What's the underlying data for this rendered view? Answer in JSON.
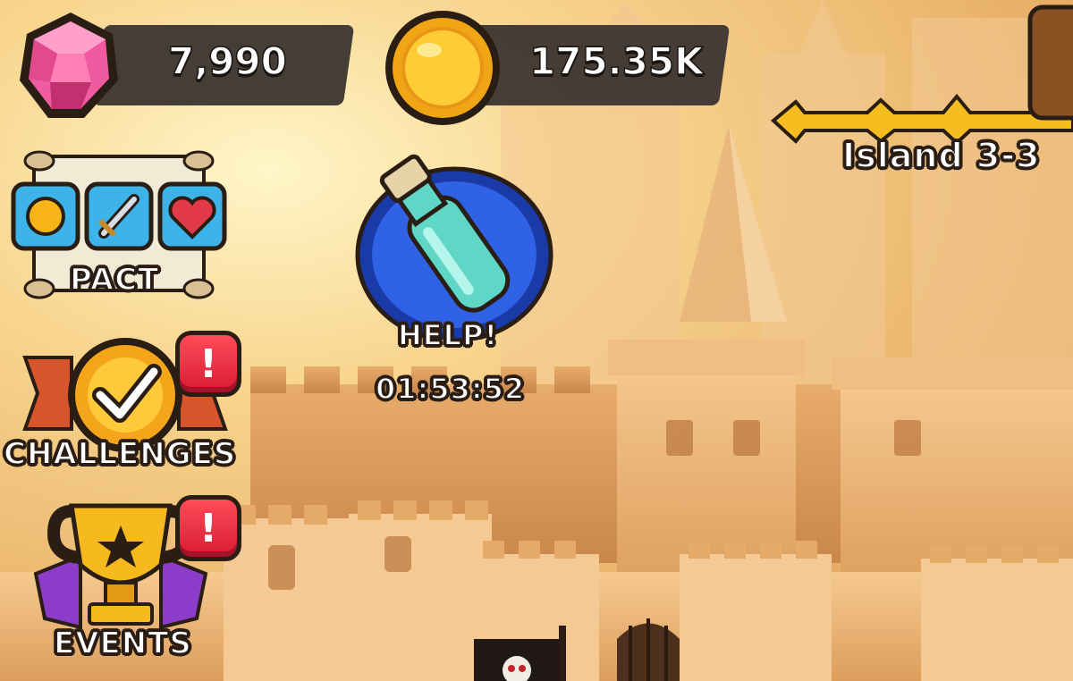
{
  "currency": {
    "gems": {
      "value": "7,990",
      "icon": "gem-icon"
    },
    "gold": {
      "value": "175.35K",
      "icon": "gold-coin-icon"
    }
  },
  "menu": {
    "pact_label": "PACT",
    "challenges_label": "CHALLENGES",
    "events_label": "EVENTS",
    "alert_glyph": "!"
  },
  "help": {
    "label": "HELP!",
    "timer": "01:53:52"
  },
  "stage": {
    "label": "Island 3-3"
  },
  "colors": {
    "gem": "#e83a8a",
    "gold": "#f4b21a",
    "badge": "#e62a3e",
    "bar": "#3b3530"
  }
}
